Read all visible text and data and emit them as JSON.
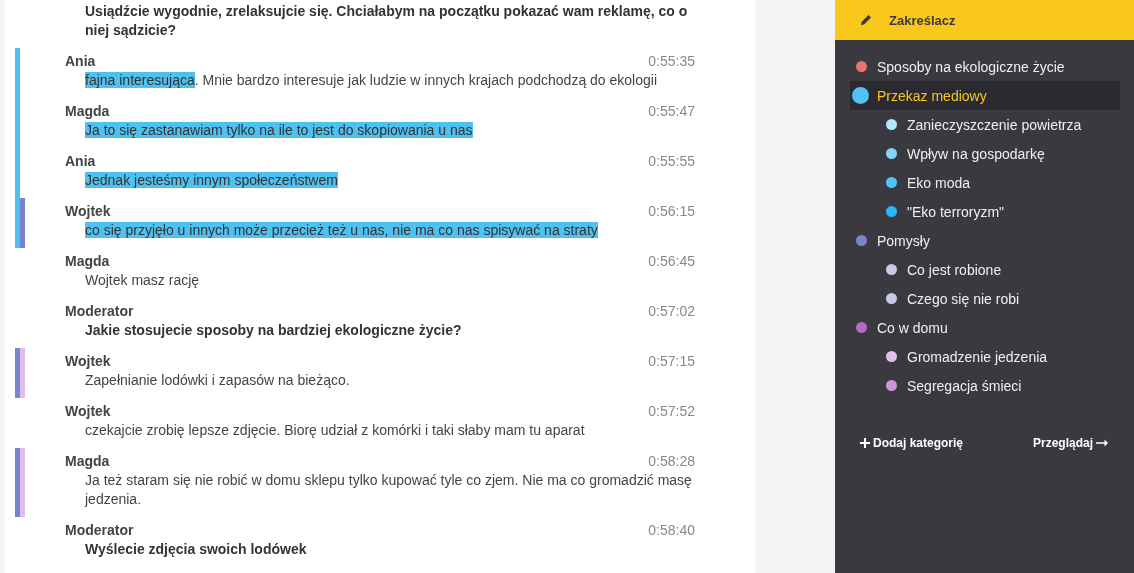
{
  "transcript": [
    {
      "bold": true,
      "segments": [
        {
          "text": "Usiądźcie wygodnie, zrelaksujcie się. Chciałabym na początku pokazać wam reklamę, co o niej sądzicie?",
          "highlighted": false
        }
      ]
    },
    {
      "speaker": "Ania",
      "time": "0:55:35",
      "bold": false,
      "marks": [
        {
          "color": "#4fc1f1"
        }
      ],
      "segments": [
        {
          "text": "fajna interesująca",
          "highlighted": true
        },
        {
          "text": ". Mnie bardzo interesuje jak ludzie w innych krajach podchodzą do ekologii",
          "highlighted": false
        }
      ]
    },
    {
      "speaker": "Magda",
      "time": "0:55:47",
      "bold": false,
      "marks": [
        {
          "color": "#4fc1f1"
        }
      ],
      "segments": [
        {
          "text": "Ja to się zastanawiam tylko na ile to jest do skopiowania u nas",
          "highlighted": true
        }
      ]
    },
    {
      "speaker": "Ania",
      "time": "0:55:55",
      "bold": false,
      "marks": [
        {
          "color": "#4fc1f1"
        }
      ],
      "segments": [
        {
          "text": "Jednak jesteśmy innym społeczeństwem",
          "highlighted": true
        }
      ]
    },
    {
      "speaker": "Wojtek",
      "time": "0:56:15",
      "bold": false,
      "marks": [
        {
          "color": "#4fc1f1"
        },
        {
          "color": "#7b83cc"
        }
      ],
      "segments": [
        {
          "text": "co się przyjęło u innych może przecież też u nas, nie ma co nas spisywać na straty",
          "highlighted": true
        }
      ]
    },
    {
      "speaker": "Magda",
      "time": "0:56:45",
      "bold": false,
      "segments": [
        {
          "text": "Wojtek masz rację",
          "highlighted": false
        }
      ]
    },
    {
      "speaker": "Moderator",
      "time": "0:57:02",
      "bold": true,
      "segments": [
        {
          "text": "Jakie stosujecie sposoby na bardziej ekologiczne życie?",
          "highlighted": false
        }
      ]
    },
    {
      "speaker": "Wojtek",
      "time": "0:57:15",
      "bold": false,
      "marks": [
        {
          "color": "#7b83cc"
        },
        {
          "color": "#e2bdea"
        }
      ],
      "segments": [
        {
          "text": "Zapełnianie lodówki i zapasów na bieżąco.",
          "highlighted": false
        }
      ]
    },
    {
      "speaker": "Wojtek",
      "time": "0:57:52",
      "bold": false,
      "segments": [
        {
          "text": "czekajcie zrobię lepsze zdjęcie. Biorę udział z komórki i taki słaby mam tu aparat",
          "highlighted": false
        }
      ]
    },
    {
      "speaker": "Magda",
      "time": "0:58:28",
      "bold": false,
      "marks": [
        {
          "color": "#7b83cc"
        },
        {
          "color": "#e2bdea"
        }
      ],
      "segments": [
        {
          "text": "Ja też staram się nie robić w domu sklepu tylko kupować tyle co zjem. Nie ma co gromadzić masę jedzenia.",
          "highlighted": false
        }
      ]
    },
    {
      "speaker": "Moderator",
      "time": "0:58:40",
      "bold": true,
      "segments": [
        {
          "text": "Wyślecie zdjęcia swoich lodówek",
          "highlighted": false
        }
      ]
    }
  ],
  "highlighter": {
    "title": "Zakreślacz",
    "categories": [
      {
        "label": "Sposoby na ekologiczne życie",
        "color": "#e57373",
        "selected": false
      },
      {
        "label": "Przekaz mediowy",
        "color": "#4fc3f7",
        "selected": true,
        "children": [
          {
            "label": "Zanieczyszczenie powietrza",
            "color": "#b3e5fc",
            "selected": false
          },
          {
            "label": "Wpływ na gospodarkę",
            "color": "#81d4fa",
            "selected": false
          },
          {
            "label": "Eko moda",
            "color": "#4fc3f7",
            "selected": false
          },
          {
            "label": "\"Eko terroryzm\"",
            "color": "#29b6f6",
            "selected": false
          }
        ]
      },
      {
        "label": "Pomysły",
        "color": "#7986cb",
        "selected": false,
        "children": [
          {
            "label": "Co jest robione",
            "color": "#c5cae9",
            "selected": false
          },
          {
            "label": "Czego się nie robi",
            "color": "#c5cae9",
            "selected": false
          }
        ]
      },
      {
        "label": "Co w domu",
        "color": "#ba68c8",
        "selected": false,
        "children": [
          {
            "label": "Gromadzenie jedzenia",
            "color": "#e1bee7",
            "selected": false
          },
          {
            "label": "Segregacja śmieci",
            "color": "#ce93d8",
            "selected": false
          }
        ]
      }
    ],
    "add_label": "Dodaj kategorię",
    "browse_label": "Przeglądaj"
  }
}
